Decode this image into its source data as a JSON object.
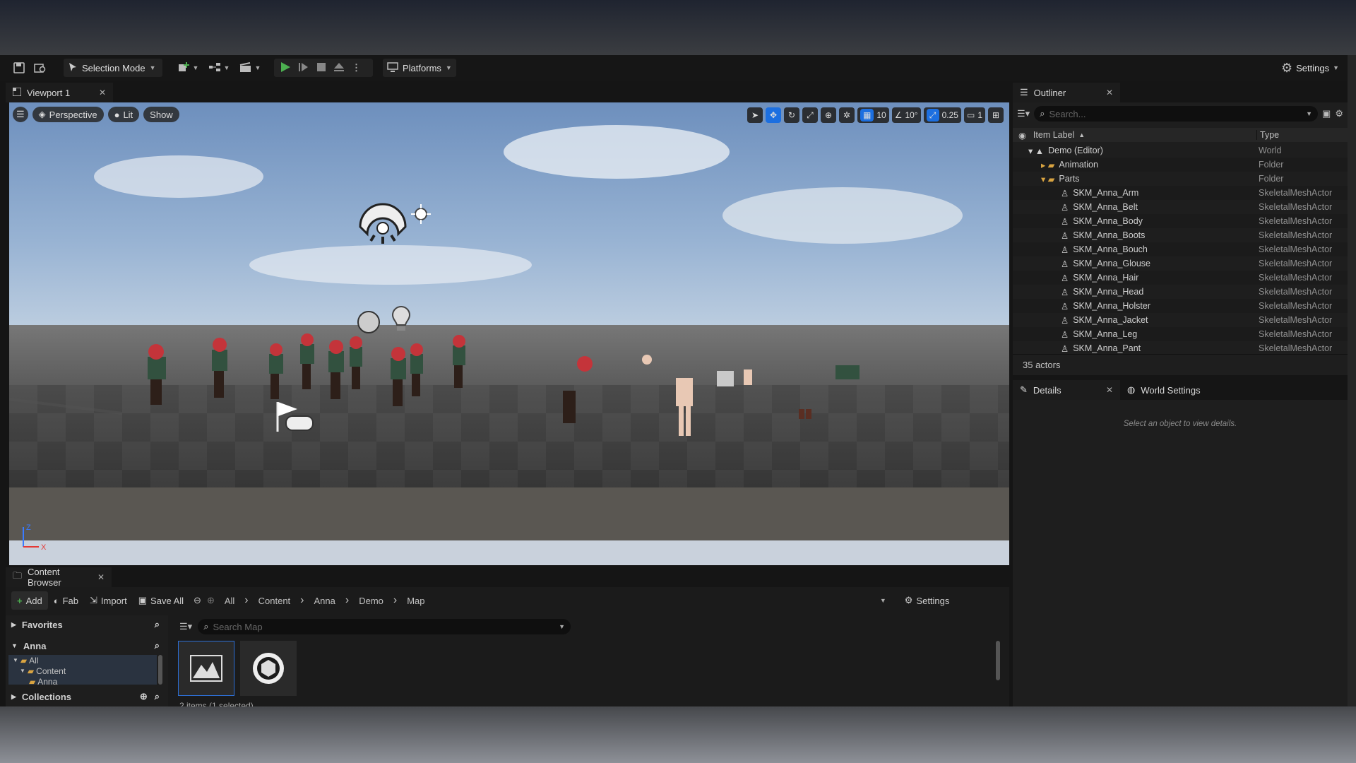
{
  "toolbar": {
    "selection_mode": "Selection Mode",
    "platforms": "Platforms",
    "settings": "Settings"
  },
  "viewport": {
    "tab": "Viewport 1",
    "perspective": "Perspective",
    "lit": "Lit",
    "show": "Show",
    "grid_snap": "10",
    "rot_snap": "10°",
    "scale_snap": "0.25",
    "camera_speed": "1",
    "axis_z": "Z",
    "axis_x": "X"
  },
  "outliner": {
    "tab": "Outliner",
    "search_placeholder": "Search...",
    "col_label": "Item Label",
    "col_type": "Type",
    "actor_count": "35 actors",
    "rows": [
      {
        "label": "Demo (Editor)",
        "type": "World"
      },
      {
        "label": "Animation",
        "type": "Folder"
      },
      {
        "label": "Parts",
        "type": "Folder"
      },
      {
        "label": "SKM_Anna_Arm",
        "type": "SkeletalMeshActor"
      },
      {
        "label": "SKM_Anna_Belt",
        "type": "SkeletalMeshActor"
      },
      {
        "label": "SKM_Anna_Body",
        "type": "SkeletalMeshActor"
      },
      {
        "label": "SKM_Anna_Boots",
        "type": "SkeletalMeshActor"
      },
      {
        "label": "SKM_Anna_Bouch",
        "type": "SkeletalMeshActor"
      },
      {
        "label": "SKM_Anna_Glouse",
        "type": "SkeletalMeshActor"
      },
      {
        "label": "SKM_Anna_Hair",
        "type": "SkeletalMeshActor"
      },
      {
        "label": "SKM_Anna_Head",
        "type": "SkeletalMeshActor"
      },
      {
        "label": "SKM_Anna_Holster",
        "type": "SkeletalMeshActor"
      },
      {
        "label": "SKM_Anna_Jacket",
        "type": "SkeletalMeshActor"
      },
      {
        "label": "SKM_Anna_Leg",
        "type": "SkeletalMeshActor"
      },
      {
        "label": "SKM_Anna_Pant",
        "type": "SkeletalMeshActor"
      }
    ]
  },
  "details": {
    "tab": "Details",
    "world_settings": "World Settings",
    "empty": "Select an object to view details."
  },
  "content_browser": {
    "tab": "Content Browser",
    "add": "Add",
    "fab": "Fab",
    "import": "Import",
    "save_all": "Save All",
    "breadcrumb": [
      "All",
      "Content",
      "Anna",
      "Demo",
      "Map"
    ],
    "settings": "Settings",
    "favorites": "Favorites",
    "anna": "Anna",
    "collections": "Collections",
    "tree": [
      "All",
      "Content",
      "Anna"
    ],
    "search_placeholder": "Search Map",
    "status": "2 items (1 selected)"
  }
}
